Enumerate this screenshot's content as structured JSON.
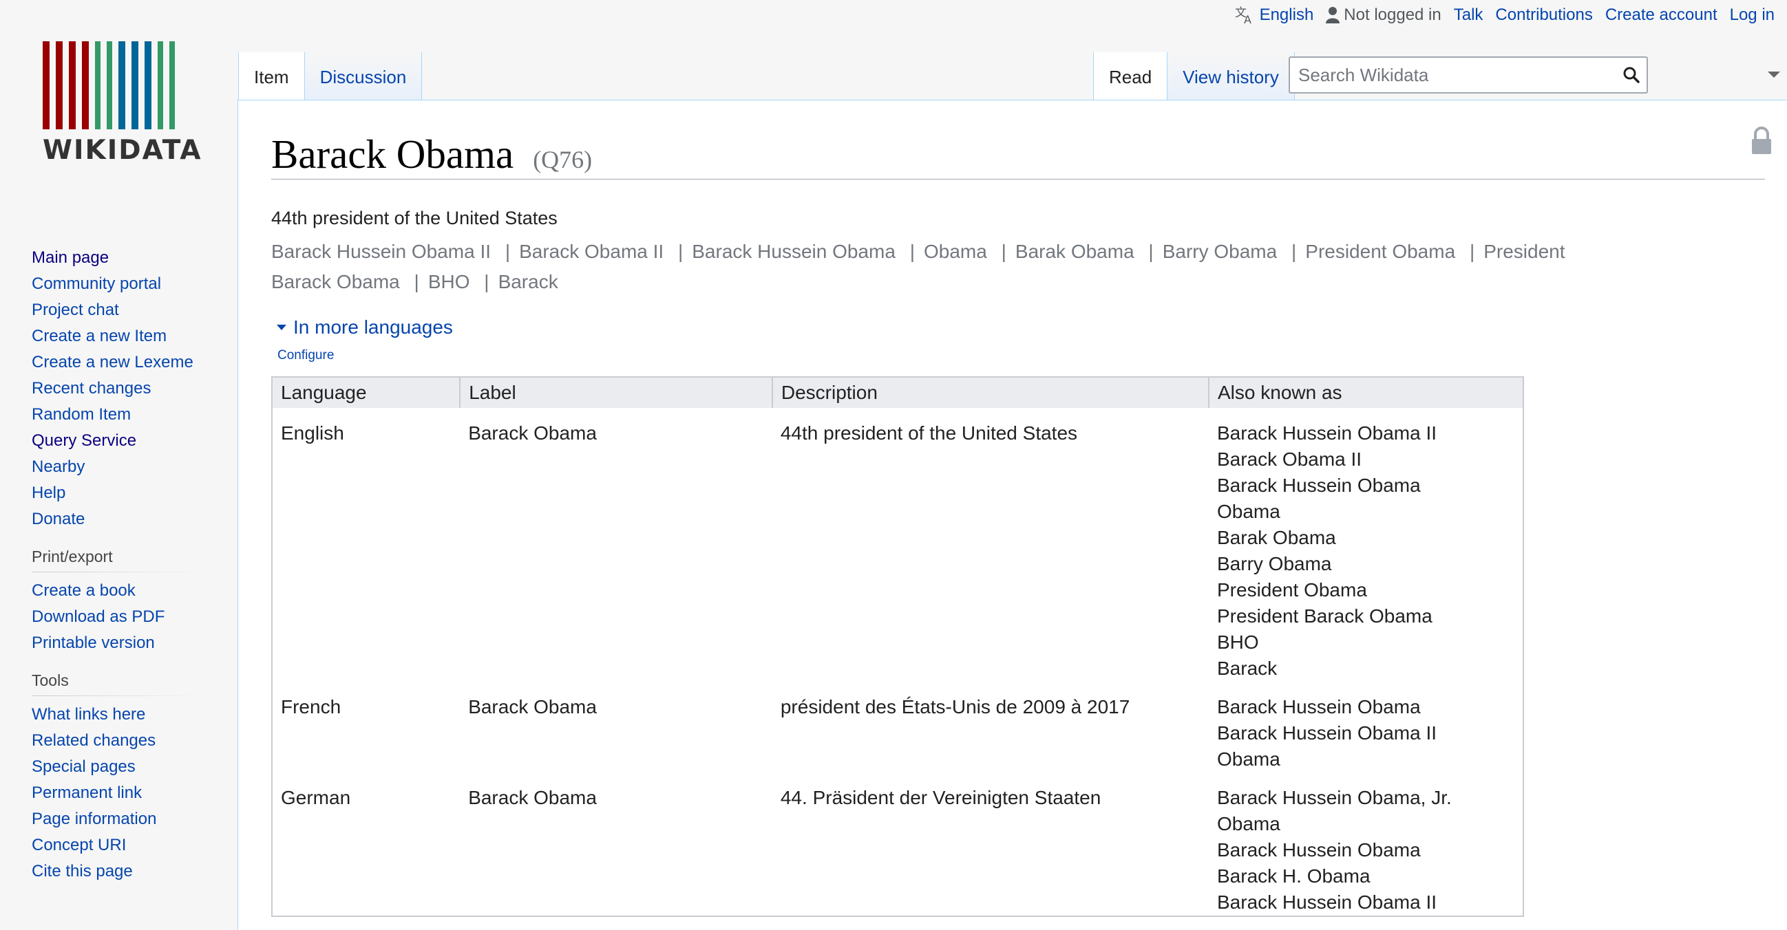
{
  "personal_tools": {
    "language": "English",
    "not_logged_in": "Not logged in",
    "talk": "Talk",
    "contributions": "Contributions",
    "create_account": "Create account",
    "log_in": "Log in"
  },
  "logo": {
    "wordmark": "WIKIDATA",
    "bar_colors": [
      "#990000",
      "#990000",
      "#990000",
      "#990000",
      "#339966",
      "#339966",
      "#006699",
      "#006699",
      "#006699",
      "#339966",
      "#339966"
    ]
  },
  "tabs": {
    "left": [
      "Item",
      "Discussion"
    ],
    "right": [
      "Read",
      "View history"
    ]
  },
  "search": {
    "placeholder": "Search Wikidata"
  },
  "sidebar": {
    "navigation": [
      "Main page",
      "Community portal",
      "Project chat",
      "Create a new Item",
      "Create a new Lexeme",
      "Recent changes",
      "Random Item",
      "Query Service",
      "Nearby",
      "Help",
      "Donate"
    ],
    "print_heading": "Print/export",
    "print": [
      "Create a book",
      "Download as PDF",
      "Printable version"
    ],
    "tools_heading": "Tools",
    "tools": [
      "What links here",
      "Related changes",
      "Special pages",
      "Permanent link",
      "Page information",
      "Concept URI",
      "Cite this page"
    ]
  },
  "item": {
    "title": "Barack Obama",
    "qid": "(Q76)",
    "description": "44th president of the United States",
    "aliases": [
      "Barack Hussein Obama II",
      "Barack Obama II",
      "Barack Hussein Obama",
      "Obama",
      "Barak Obama",
      "Barry Obama",
      "President Obama",
      "President Barack Obama",
      "BHO",
      "Barack"
    ],
    "alias_separator": "|"
  },
  "languages": {
    "toggle": "In more languages",
    "configure": "Configure",
    "headers": [
      "Language",
      "Label",
      "Description",
      "Also known as"
    ],
    "rows": [
      {
        "language": "English",
        "label": "Barack Obama",
        "description": "44th president of the United States",
        "aliases": [
          "Barack Hussein Obama II",
          "Barack Obama II",
          "Barack Hussein Obama",
          "Obama",
          "Barak Obama",
          "Barry Obama",
          "President Obama",
          "President Barack Obama",
          "BHO",
          "Barack"
        ]
      },
      {
        "language": "French",
        "label": "Barack Obama",
        "description": "président des États-Unis de 2009 à 2017",
        "aliases": [
          "Barack Hussein Obama",
          "Barack Hussein Obama II",
          "Obama"
        ]
      },
      {
        "language": "German",
        "label": "Barack Obama",
        "description": "44. Präsident der Vereinigten Staaten",
        "aliases": [
          "Barack Hussein Obama, Jr.",
          "Obama",
          "Barack Hussein Obama",
          "Barack H. Obama",
          "Barack Hussein Obama II"
        ]
      }
    ]
  }
}
